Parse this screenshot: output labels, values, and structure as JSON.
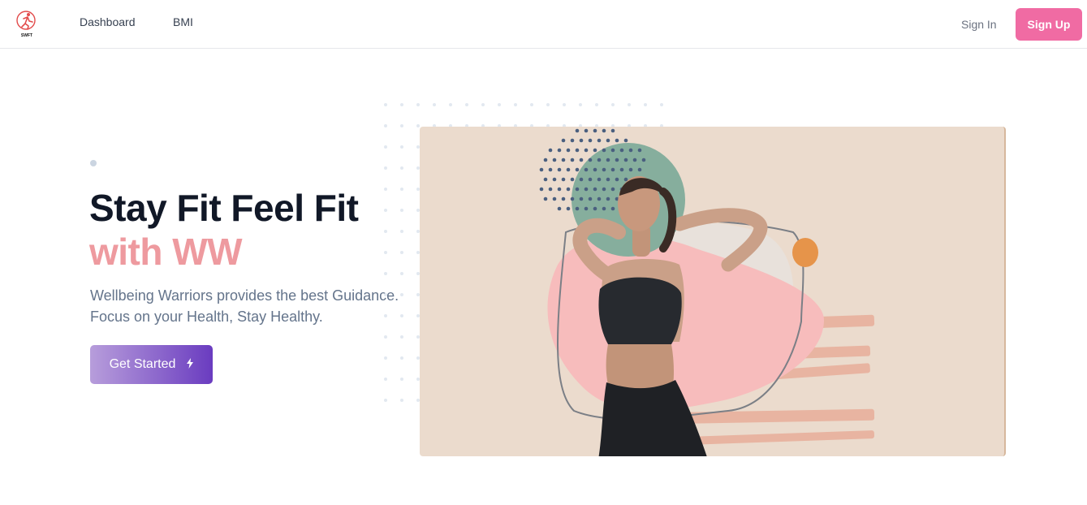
{
  "header": {
    "logo_text": "SWFT",
    "nav": [
      {
        "label": "Dashboard"
      },
      {
        "label": "BMI"
      }
    ],
    "sign_in": "Sign In",
    "sign_up": "Sign Up"
  },
  "hero": {
    "title_line1": "Stay Fit Feel Fit",
    "title_line2": "with WW",
    "description": "Wellbeing Warriors provides the best Guidance. Focus on your Health, Stay Healthy.",
    "cta_label": "Get Started",
    "cta_icon": "lightning-icon",
    "image_alt": "woman in sports wear with hands behind head"
  },
  "colors": {
    "accent_pink": "#f06ba3",
    "title_pink": "#ee9a9f",
    "cta_gradient_start": "#b79ddb",
    "cta_gradient_end": "#6a3cc0"
  }
}
